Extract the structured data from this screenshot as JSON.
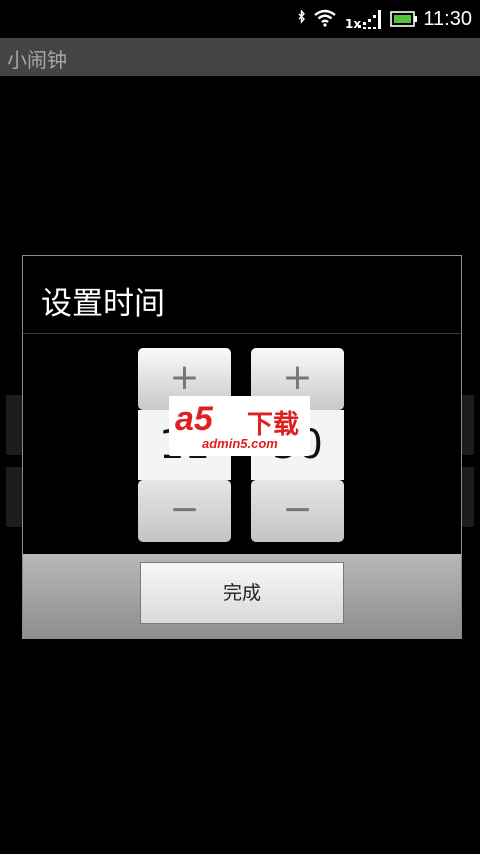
{
  "status_bar": {
    "time": "11:30",
    "network_label": "1x",
    "icons": [
      "bluetooth-icon",
      "wifi-icon",
      "signal-icon",
      "battery-icon"
    ],
    "battery_color": "#54c23a"
  },
  "app": {
    "title": "小闹钟"
  },
  "dialog": {
    "title": "设置时间",
    "hour_picker": {
      "increment_label": "+",
      "value": "11",
      "decrement_label": "−"
    },
    "minute_picker": {
      "increment_label": "+",
      "value": "30",
      "decrement_label": "−"
    },
    "done_label": "完成"
  },
  "watermark": {
    "brand": "a5",
    "chinese": "下载",
    "url": "admin5.com",
    "color": "#e02020"
  }
}
